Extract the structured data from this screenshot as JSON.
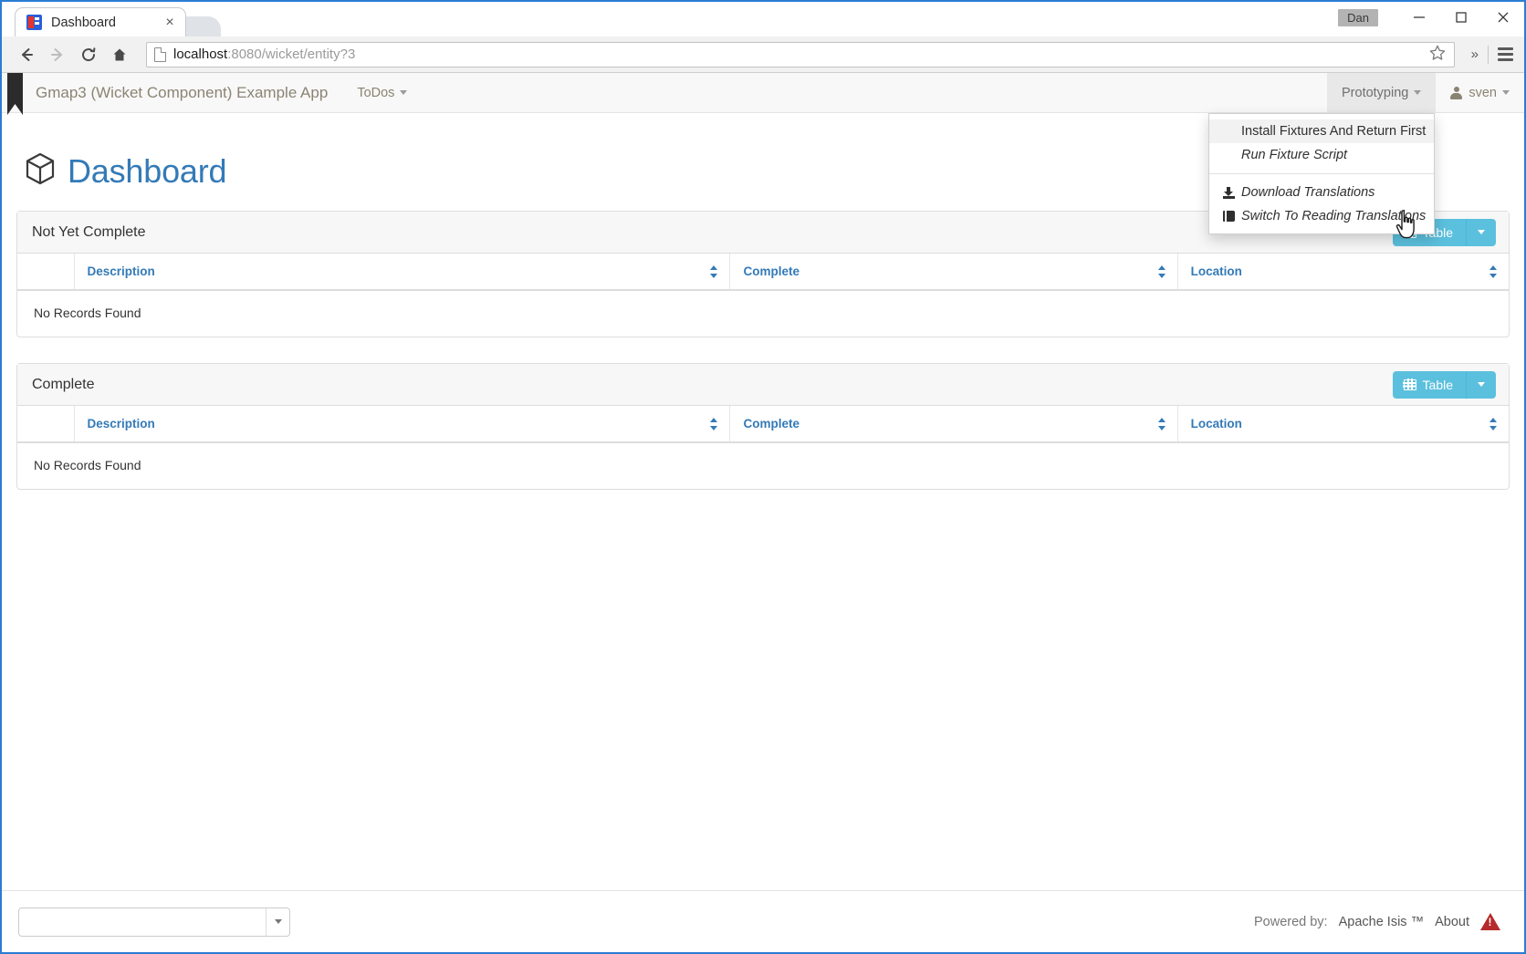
{
  "browser": {
    "tab": {
      "title": "Dashboard",
      "favicon": "apache-isis-favicon",
      "close_label": "×"
    },
    "window": {
      "user_badge": "Dan",
      "minimize": "–",
      "maximize": "□",
      "close": "✕"
    },
    "toolbar": {
      "back": "←",
      "forward": "→",
      "reload": "⟳",
      "home": "⌂",
      "url_host": "localhost",
      "url_rest": ":8080/wicket/entity?3",
      "bookmark_star": "☆",
      "overflow": "»",
      "menu": "hamburger-icon"
    }
  },
  "appnav": {
    "brand": "Gmap3 (Wicket Component) Example App",
    "items": [
      {
        "label": "ToDos",
        "has_caret": true
      }
    ],
    "right_items": [
      {
        "label": "Prototyping",
        "has_caret": true,
        "active": true
      },
      {
        "label": "sven",
        "has_caret": true,
        "icon": "user-icon"
      }
    ]
  },
  "prototyping_menu": {
    "items": [
      {
        "label": "Install Fixtures And Return First",
        "icon": null,
        "hover": true
      },
      {
        "label": "Run Fixture Script",
        "icon": null,
        "hover": false
      },
      {
        "separator": true
      },
      {
        "label": "Download Translations",
        "icon": "download-icon",
        "hover": false
      },
      {
        "label": "Switch To Reading Translations",
        "icon": "book-icon",
        "hover": false
      }
    ]
  },
  "page": {
    "title": "Dashboard",
    "title_icon": "cube-icon",
    "title_color": "#337ab7"
  },
  "panels": [
    {
      "title": "Not Yet Complete",
      "view_button": {
        "label": "Table",
        "icon": "grid-icon",
        "caret": true
      },
      "columns": [
        "",
        "Description",
        "Complete",
        "Location"
      ],
      "rows": [],
      "empty_message": "No Records Found"
    },
    {
      "title": "Complete",
      "view_button": {
        "label": "Table",
        "icon": "grid-icon",
        "caret": true
      },
      "columns": [
        "",
        "Description",
        "Complete",
        "Location"
      ],
      "rows": [],
      "empty_message": "No Records Found"
    }
  ],
  "footer": {
    "select_value": "",
    "powered_by_label": "Powered by:",
    "vendor": "Apache Isis ™",
    "about_label": "About",
    "about_icon": "warning-triangle-icon"
  },
  "colors": {
    "accent_blue": "#337ab7",
    "info_blue": "#5bc0de",
    "warning_red": "#b52b2b",
    "chrome_blue": "#2b7cd3"
  }
}
